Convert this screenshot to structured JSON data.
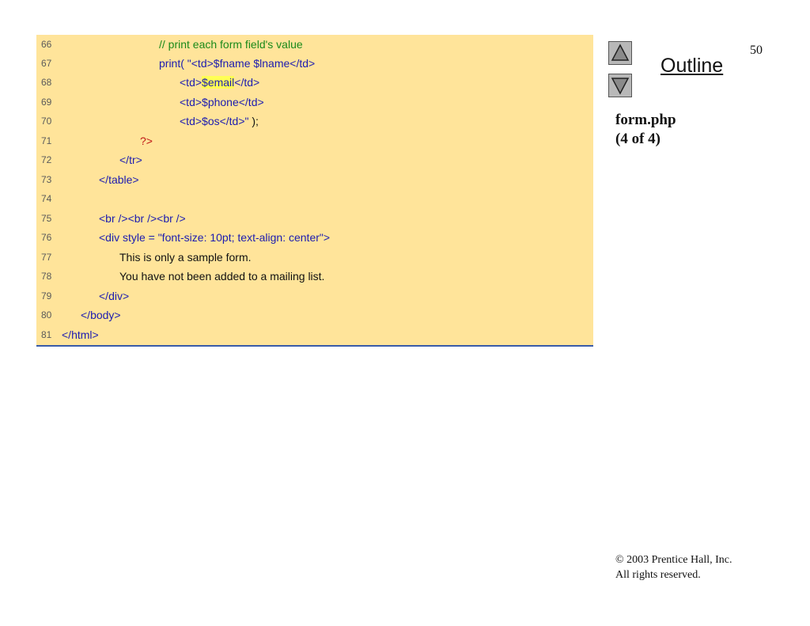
{
  "slide": {
    "page_number": "50",
    "outline_label": "Outline",
    "file_name": "form.php",
    "part": "(4 of 4)",
    "nav": {
      "up_icon": "triangle-up-icon",
      "down_icon": "triangle-down-icon"
    },
    "copyright": "© 2003 Prentice Hall, Inc.",
    "rights": "All rights reserved."
  },
  "colors": {
    "panel_bg": "#FFE49A",
    "comment": "#1a8a1a",
    "keyword": "#1c1cb0",
    "php_tag": "#c01818",
    "highlight": "#ffff55",
    "rule": "#3A5BA8"
  },
  "code": [
    {
      "num": "66",
      "segments": [
        {
          "t": "// print each form field's value",
          "c": "comment"
        }
      ]
    },
    {
      "num": "67",
      "segments": [
        {
          "t": "print( \"<td>$fname $lname</td>",
          "c": "kw"
        }
      ]
    },
    {
      "num": "68",
      "segments": [
        {
          "t": "<td>",
          "c": "kw"
        },
        {
          "t": "$email",
          "c": "kw",
          "hl": true
        },
        {
          "t": "</td>",
          "c": "kw"
        }
      ]
    },
    {
      "num": "69",
      "segments": [
        {
          "t": "<td>$phone</td>",
          "c": "kw"
        }
      ]
    },
    {
      "num": "70",
      "segments": [
        {
          "t": "<td>$os</td>\" ",
          "c": "kw"
        },
        {
          "t": ");",
          "c": "plain"
        }
      ]
    },
    {
      "num": "71",
      "segments": [
        {
          "t": "?>",
          "c": "php"
        }
      ]
    },
    {
      "num": "72",
      "segments": [
        {
          "t": "</tr>",
          "c": "kw"
        }
      ]
    },
    {
      "num": "73",
      "segments": [
        {
          "t": "</table>",
          "c": "kw"
        }
      ]
    },
    {
      "num": "74",
      "segments": []
    },
    {
      "num": "75",
      "segments": [
        {
          "t": "<br /><br /><br />",
          "c": "kw"
        }
      ]
    },
    {
      "num": "76",
      "segments": [
        {
          "t": "<div style = \"font-size: 10pt; text-align: center\">",
          "c": "kw"
        }
      ]
    },
    {
      "num": "77",
      "segments": [
        {
          "t": "This is only a sample form.",
          "c": "plain"
        }
      ]
    },
    {
      "num": "78",
      "segments": [
        {
          "t": "You have not been added to a mailing list.",
          "c": "plain"
        }
      ]
    },
    {
      "num": "79",
      "segments": [
        {
          "t": "</div>",
          "c": "kw"
        }
      ]
    },
    {
      "num": "80",
      "segments": [
        {
          "t": "</body>",
          "c": "kw"
        }
      ]
    },
    {
      "num": "81",
      "segments": [
        {
          "t": "</html>",
          "c": "kw"
        }
      ]
    }
  ]
}
